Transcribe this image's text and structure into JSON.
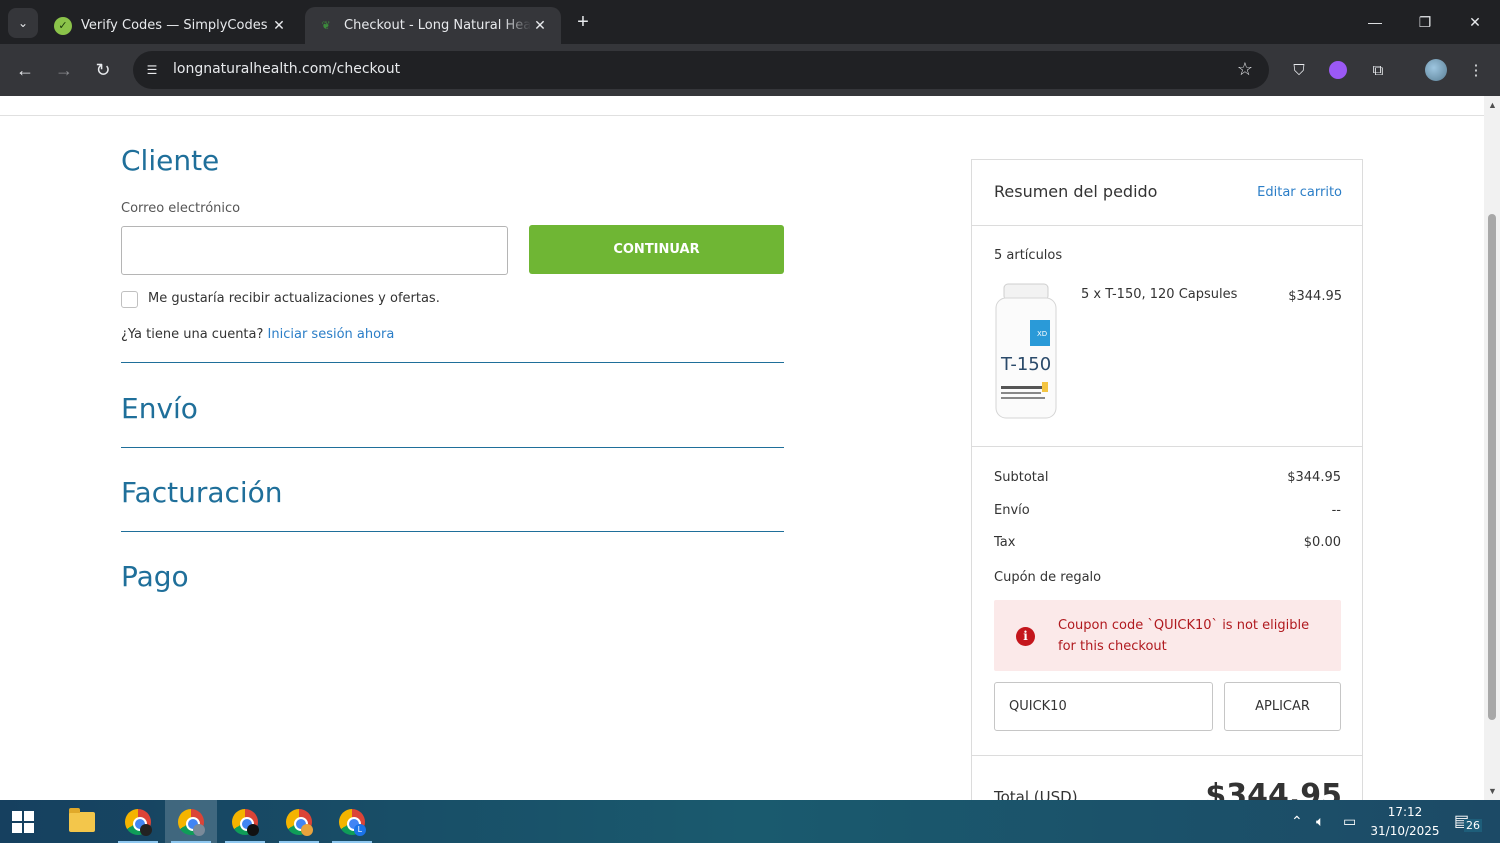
{
  "browser": {
    "tabs": [
      {
        "title": "Verify Codes — SimplyCodes",
        "active": false
      },
      {
        "title": "Checkout - Long Natural Health",
        "active": true
      }
    ],
    "url": "longnaturalhealth.com/checkout"
  },
  "checkout": {
    "customer": {
      "title": "Cliente",
      "email_label": "Correo electrónico",
      "email_value": "",
      "continue_label": "CONTINUAR",
      "newsletter_label": "Me gustaría recibir actualizaciones y ofertas.",
      "account_prompt": "¿Ya tiene una cuenta?",
      "login_link": "Iniciar sesión ahora"
    },
    "shipping_title": "Envío",
    "billing_title": "Facturación",
    "payment_title": "Pago"
  },
  "summary": {
    "title": "Resumen del pedido",
    "edit_cart": "Editar carrito",
    "items_count": "5 artículos",
    "product": {
      "name": "5 x T-150, 120 Capsules",
      "price": "$344.95",
      "bottle_label": "T-150"
    },
    "subtotal_label": "Subtotal",
    "subtotal_value": "$344.95",
    "shipping_label": "Envío",
    "shipping_value": "--",
    "tax_label": "Tax",
    "tax_value": "$0.00",
    "coupon_label": "Cupón de regalo",
    "coupon_error": "Coupon code `QUICK10` is not eligible for this checkout",
    "coupon_value": "QUICK10",
    "apply_label": "APLICAR",
    "total_label": "Total (USD)",
    "total_value": "$344.95"
  },
  "taskbar": {
    "time": "17:12",
    "date": "31/10/2025",
    "notifications": "26"
  },
  "colors": {
    "accent_blue": "#1f6f9a",
    "link_blue": "#2b7ec7",
    "continue_green": "#6fb634",
    "error_red": "#b0191e",
    "error_bg": "#fbe9e9"
  }
}
